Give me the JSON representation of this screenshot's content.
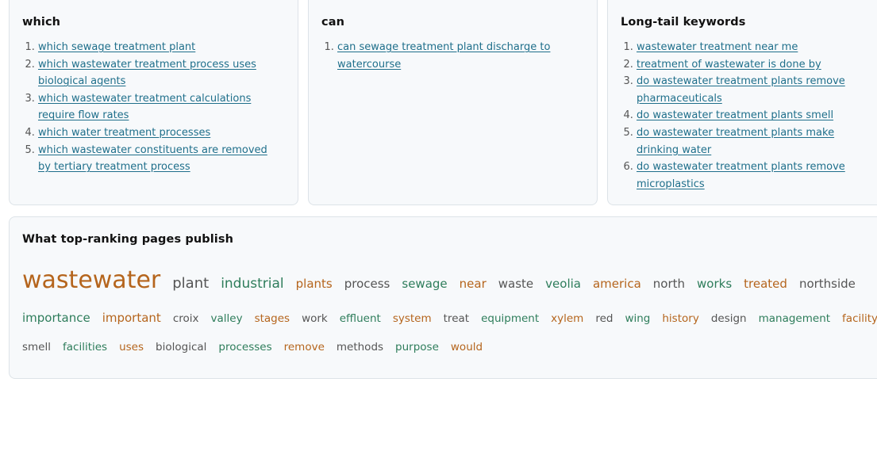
{
  "cards": {
    "which": {
      "title": "which",
      "items": [
        "which sewage treatment plant",
        "which wastewater treatment process uses biological agents",
        "which wastewater treatment calculations require flow rates",
        "which water treatment processes",
        "which wastewater constituents are removed by tertiary treatment process"
      ]
    },
    "can": {
      "title": "can",
      "items": [
        "can sewage treatment plant discharge to watercourse"
      ]
    },
    "long_tail": {
      "title": "Long-tail keywords",
      "items": [
        "wastewater treatment near me",
        "treatment of wastewater is done by",
        "do wastewater treatment plants remove pharmaceuticals",
        "do wastewater treatment plants smell",
        "do wastewater treatment plants make drinking water",
        "do wastewater treatment plants remove microplastics"
      ]
    }
  },
  "cloud": {
    "title": "What top-ranking pages publish",
    "rows": [
      [
        {
          "text": "wastewater",
          "color": "#b5651d"
        },
        {
          "text": "plant",
          "color": "#555555"
        },
        {
          "text": "industrial",
          "color": "#2e7d5b"
        },
        {
          "text": "plants",
          "color": "#b5651d"
        },
        {
          "text": "process",
          "color": "#555555"
        },
        {
          "text": "sewage",
          "color": "#2e7d5b"
        },
        {
          "text": "near",
          "color": "#b5651d"
        },
        {
          "text": "waste",
          "color": "#555555"
        },
        {
          "text": "veolia",
          "color": "#2e7d5b"
        },
        {
          "text": "america",
          "color": "#b5651d"
        },
        {
          "text": "north",
          "color": "#555555"
        },
        {
          "text": "works",
          "color": "#2e7d5b"
        },
        {
          "text": "treated",
          "color": "#b5651d"
        },
        {
          "text": "northside",
          "color": "#555555"
        }
      ],
      [
        {
          "text": "importance",
          "color": "#2e7d5b"
        },
        {
          "text": "important",
          "color": "#b5651d"
        },
        {
          "text": "croix",
          "color": "#555555"
        },
        {
          "text": "valley",
          "color": "#2e7d5b"
        },
        {
          "text": "stages",
          "color": "#b5651d"
        },
        {
          "text": "work",
          "color": "#555555"
        },
        {
          "text": "effluent",
          "color": "#2e7d5b"
        },
        {
          "text": "system",
          "color": "#b5651d"
        },
        {
          "text": "treat",
          "color": "#555555"
        },
        {
          "text": "equipment",
          "color": "#2e7d5b"
        },
        {
          "text": "xylem",
          "color": "#b5651d"
        },
        {
          "text": "red",
          "color": "#555555"
        },
        {
          "text": "wing",
          "color": "#2e7d5b"
        },
        {
          "text": "history",
          "color": "#b5651d"
        },
        {
          "text": "design",
          "color": "#555555"
        },
        {
          "text": "management",
          "color": "#2e7d5b"
        },
        {
          "text": "facility",
          "color": "#b5651d"
        }
      ],
      [
        {
          "text": "smell",
          "color": "#555555"
        },
        {
          "text": "facilities",
          "color": "#2e7d5b"
        },
        {
          "text": "uses",
          "color": "#b5651d"
        },
        {
          "text": "biological",
          "color": "#555555"
        },
        {
          "text": "processes",
          "color": "#2e7d5b"
        },
        {
          "text": "remove",
          "color": "#b5651d"
        },
        {
          "text": "methods",
          "color": "#555555"
        },
        {
          "text": "purpose",
          "color": "#2e7d5b"
        },
        {
          "text": "would",
          "color": "#b5651d"
        }
      ]
    ]
  }
}
